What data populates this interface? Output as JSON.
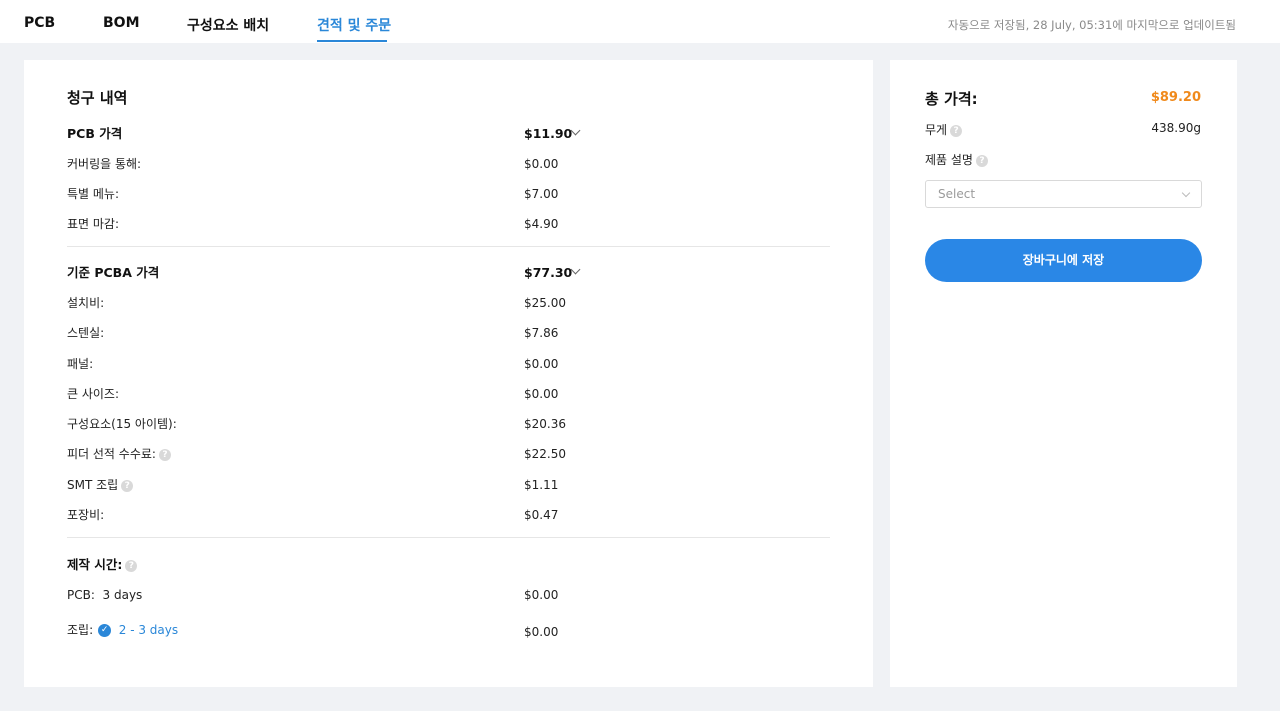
{
  "tabs": [
    {
      "label": "PCB"
    },
    {
      "label": "BOM"
    },
    {
      "label": "구성요소 배치"
    },
    {
      "label": "견적 및 주문",
      "active": true
    }
  ],
  "autosave_text": "자동으로 저장됨, 28 July, 05:31에 마지막으로 업데이트됨",
  "billing": {
    "title": "청구 내역",
    "pcb_section": {
      "label": "PCB 가격",
      "value": "$11.90",
      "rows": [
        {
          "label": "커버링을 통해:",
          "value": "$0.00"
        },
        {
          "label": "특별 메뉴:",
          "value": "$7.00"
        },
        {
          "label": "표면 마감:",
          "value": "$4.90"
        }
      ]
    },
    "pcba_section": {
      "label": "기준 PCBA 가격",
      "value": "$77.30",
      "rows": [
        {
          "label": "설치비:",
          "value": "$25.00"
        },
        {
          "label": "스텐실:",
          "value": "$7.86"
        },
        {
          "label": "패널:",
          "value": "$0.00"
        },
        {
          "label": "큰 사이즈:",
          "value": "$0.00"
        },
        {
          "label": "구성요소(15 아이템):",
          "value": "$20.36"
        },
        {
          "label": "피더 선적 수수료:",
          "value": "$22.50"
        },
        {
          "label": "SMT 조립",
          "value": "$1.11"
        },
        {
          "label": "포장비:",
          "value": "$0.47"
        }
      ]
    },
    "lead_time": {
      "label": "제작 시간:",
      "pcb_label": "PCB:",
      "pcb_days": "3 days",
      "pcb_value": "$0.00",
      "assembly_label": "조립:",
      "assembly_days": "2 - 3 days",
      "assembly_value": "$0.00"
    }
  },
  "summary": {
    "total_label": "총 가격:",
    "total_value": "$89.20",
    "weight_label": "무게",
    "weight_value": "438.90g",
    "product_desc_label": "제품 설명",
    "select_placeholder": "Select",
    "save_button": "장바구니에 저장"
  },
  "colors": {
    "accent": "#2a87d8",
    "total": "#f08a1c"
  }
}
